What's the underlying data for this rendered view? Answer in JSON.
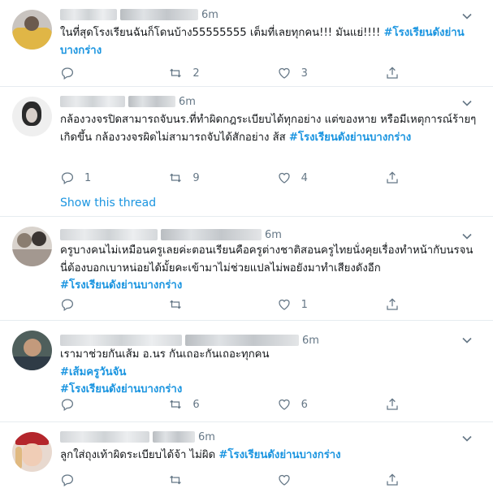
{
  "tweets": [
    {
      "time": "6m",
      "text": "ในที่สุดโรงเรียนฉันก็โดนบ้าง55555555 เต็มที่เลยทุกคน!!! มันแย่!!!! ",
      "hashtags": [
        "#โรงเรียนดังย่านบางกร่าง"
      ],
      "replies": "",
      "retweets": "2",
      "likes": "3"
    },
    {
      "time": "6m",
      "text": "กล้องวงจรปิดสามารถจับนร.ที่ทำผิดกฎระเบียบได้ทุกอย่าง แต่ของหาย หรือมีเหตุการณ์ร้ายๆเกิดขึ้น กล้องวงจรผิดไม่สามารถจับได้สักอย่าง ส้ส ",
      "hashtags": [
        "#โรงเรียนดังย่านบางกร่าง"
      ],
      "replies": "1",
      "retweets": "9",
      "likes": "4",
      "thread_label": "Show this thread"
    },
    {
      "time": "6m",
      "text": "ครูบางคนไม่เหมือนครูเลยค่ะตอนเรียนคือครูต่างชาติสอนครูไทยนั่งคุยเรื่องทำหน้ากับนรจนนี่ต้องบอกเบาหน่อยได้มั้ยคะเข้ามาไม่ช่วยแปลไม่พอยังมาทำเสียงดังอีก",
      "hashtags": [
        "#โรงเรียนดังย่านบางกร่าง"
      ],
      "replies": "",
      "retweets": "",
      "likes": "1"
    },
    {
      "time": "6m",
      "text": "เรามาช่วยกันเส้ม อ.นร กันเถอะกันเถอะทุกคน",
      "hashtags": [
        "#เส้มครูวันจัน",
        "#โรงเรียนดังย่านบางกร่าง"
      ],
      "replies": "",
      "retweets": "6",
      "likes": "6"
    },
    {
      "time": "6m",
      "text": "ลูกใส่ถุงเท้าผิดระเบียบได้จ้า ไม่ผิด ",
      "hashtags": [
        "#โรงเรียนดังย่านบางกร่าง"
      ],
      "replies": "",
      "retweets": "",
      "likes": ""
    }
  ],
  "icons": {
    "reply": "reply-icon",
    "retweet": "retweet-icon",
    "like": "heart-icon",
    "share": "share-icon",
    "menu": "chevron-down-icon"
  },
  "colors": {
    "link": "#1b95e0",
    "muted": "#657786",
    "divider": "#e6ecf0"
  }
}
